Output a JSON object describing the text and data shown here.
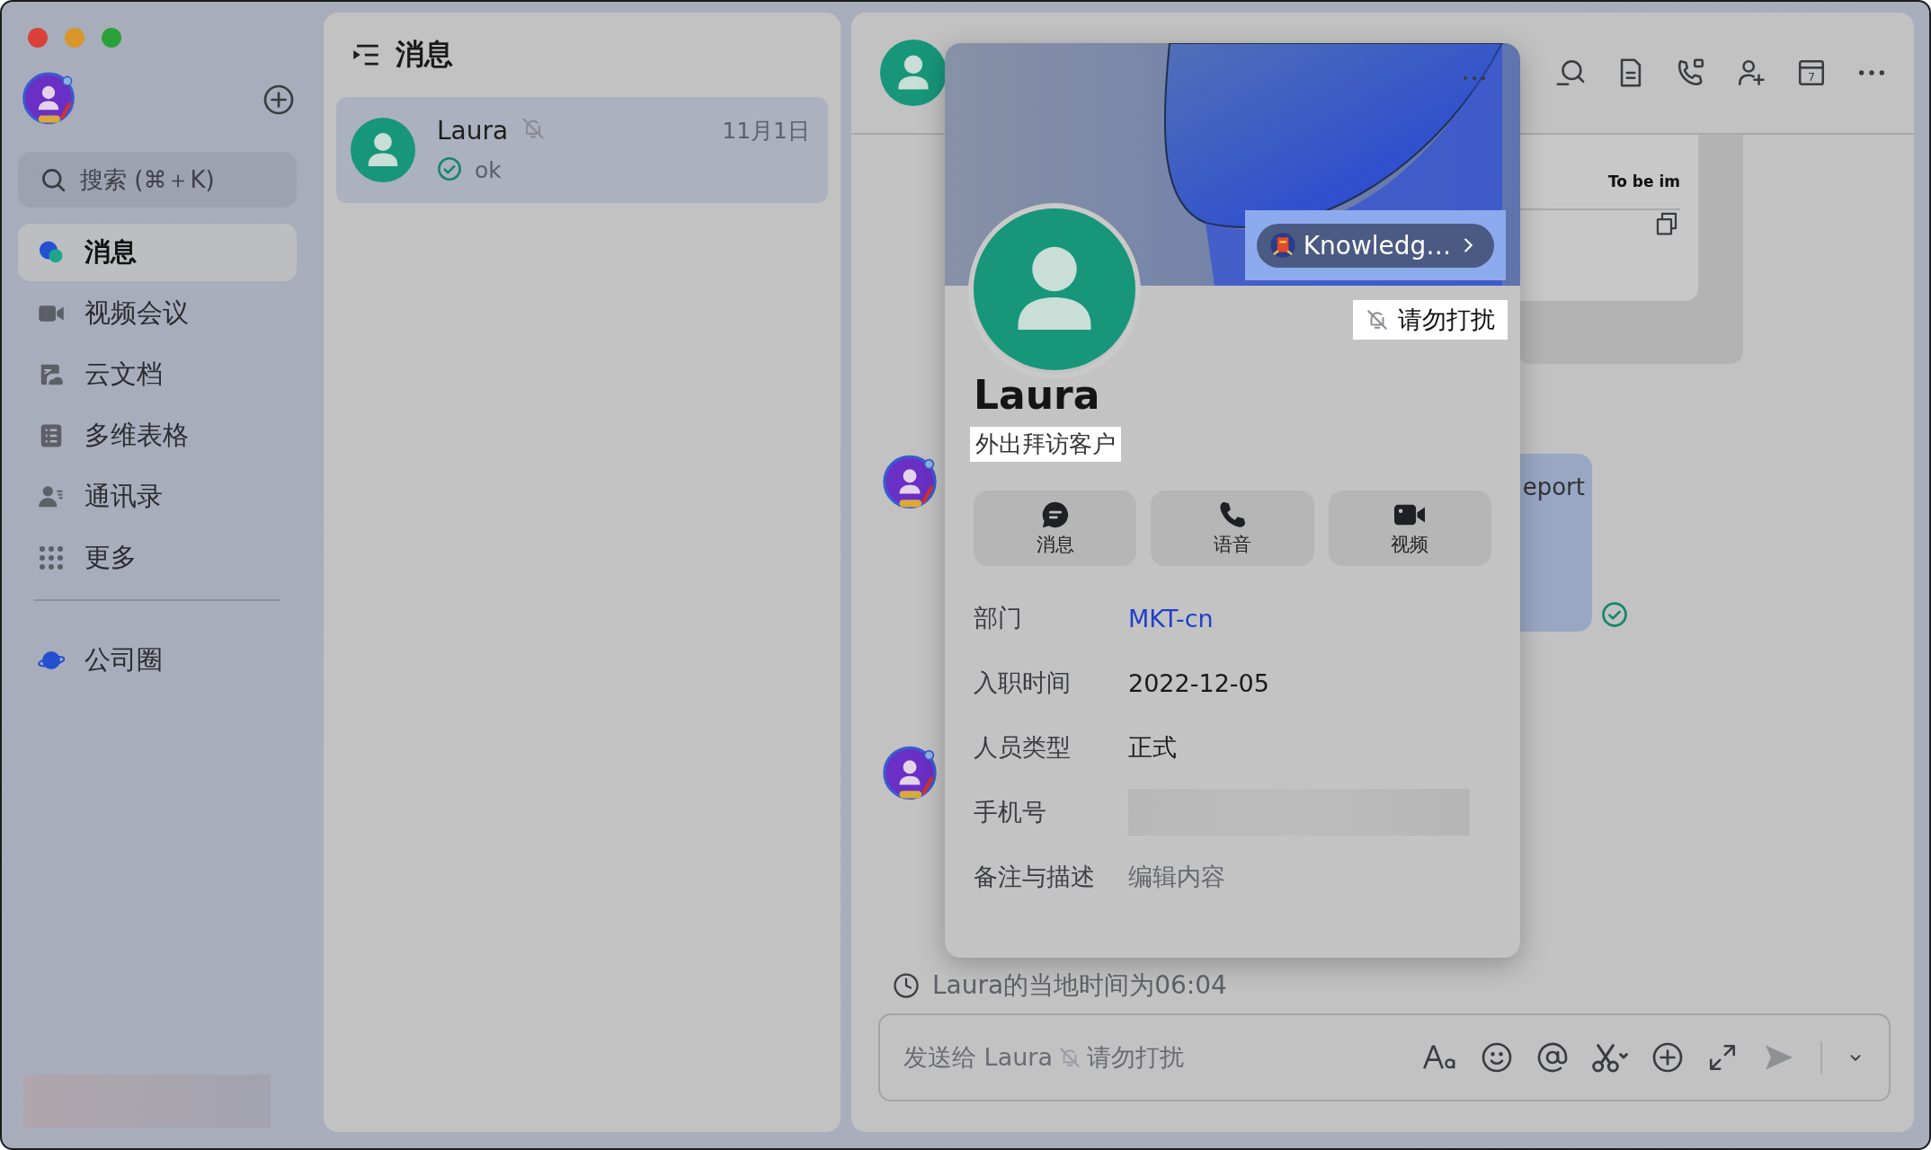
{
  "sidebar": {
    "search": {
      "placeholder": "搜索 (⌘＋K)"
    },
    "items": [
      {
        "label": "消息",
        "selected": true
      },
      {
        "label": "视频会议",
        "selected": false
      },
      {
        "label": "云文档",
        "selected": false
      },
      {
        "label": "多维表格",
        "selected": false
      },
      {
        "label": "通讯录",
        "selected": false
      },
      {
        "label": "更多",
        "selected": false
      }
    ],
    "extra_items": [
      {
        "label": "公司圈",
        "selected": false
      }
    ]
  },
  "conversation_list": {
    "title": "消息",
    "conversations": [
      {
        "name": "Laura",
        "muted": true,
        "time": "11月1日",
        "preview": "ok",
        "read": true,
        "selected": true
      }
    ]
  },
  "chat": {
    "calendar_day": "7",
    "card_text": "To be im",
    "bubble_text": "eport",
    "bubble_read": true,
    "local_time": "Laura的当地时间为06:04",
    "composer": {
      "placeholder": "发送给 Laura",
      "status": "请勿打扰"
    }
  },
  "profile": {
    "badge": "Knowledg…",
    "status_tag": "请勿打扰",
    "name": "Laura",
    "signature": "外出拜访客户",
    "actions": [
      {
        "label": "消息"
      },
      {
        "label": "语音"
      },
      {
        "label": "视频"
      }
    ],
    "fields": [
      {
        "label": "部门",
        "value": "MKT-cn",
        "kind": "link"
      },
      {
        "label": "入职时间",
        "value": "2022-12-05",
        "kind": "text"
      },
      {
        "label": "人员类型",
        "value": "正式",
        "kind": "text"
      },
      {
        "label": "手机号",
        "kind": "hidden"
      },
      {
        "label": "备注与描述",
        "placeholder": "编辑内容",
        "kind": "hint"
      }
    ]
  }
}
